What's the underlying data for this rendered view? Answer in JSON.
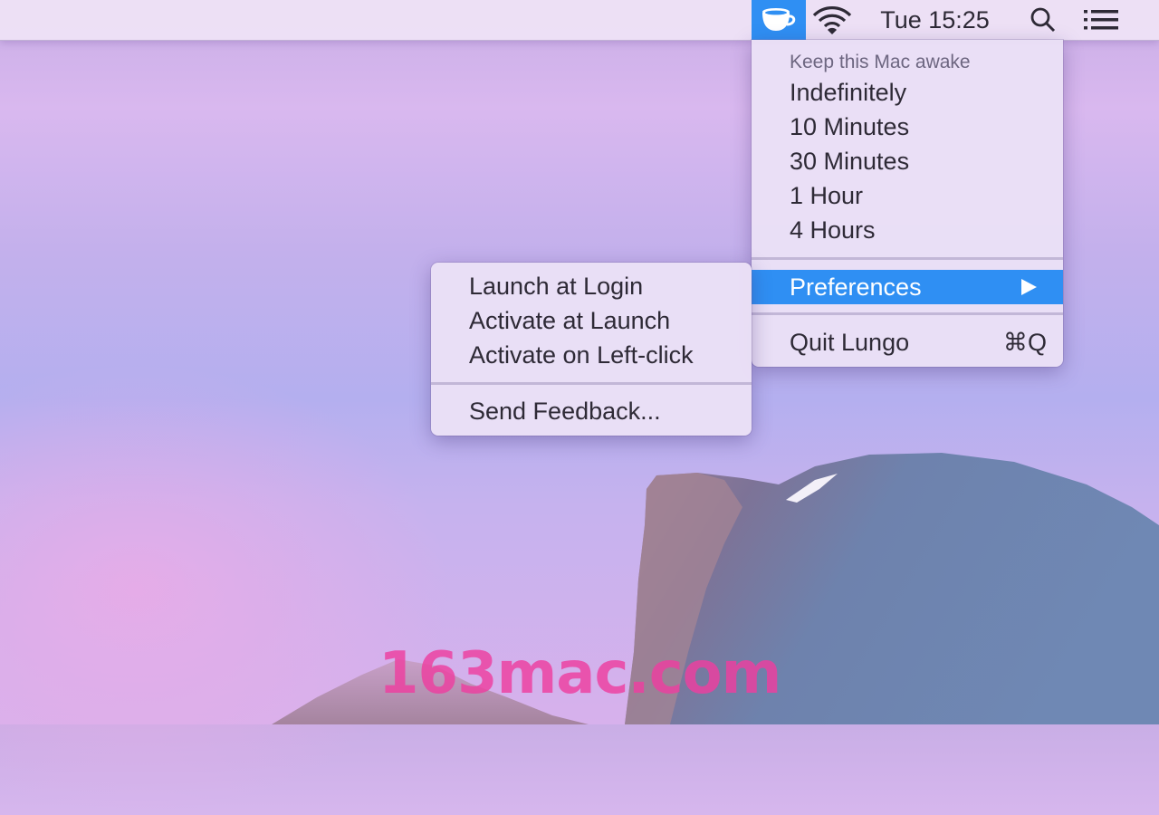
{
  "menubar": {
    "app_icon": "coffee-cup-icon",
    "wifi_icon": "wifi-icon",
    "clock": "Tue 15:25",
    "search_icon": "spotlight-search-icon",
    "notification_icon": "notification-center-list-icon",
    "accent_color": "#2f8ff3"
  },
  "main_menu": {
    "header": "Keep this Mac awake",
    "durations": [
      "Indefinitely",
      "10 Minutes",
      "30 Minutes",
      "1 Hour",
      "4 Hours"
    ],
    "preferences": {
      "label": "Preferences",
      "highlighted": true,
      "arrow_icon": "submenu-arrow-icon"
    },
    "quit": {
      "label": "Quit Lungo",
      "shortcut": "⌘Q"
    }
  },
  "preferences_submenu": {
    "items": [
      "Launch at Login",
      "Activate at Launch",
      "Activate on Left-click"
    ],
    "feedback": "Send Feedback..."
  },
  "watermark": "163mac.com"
}
